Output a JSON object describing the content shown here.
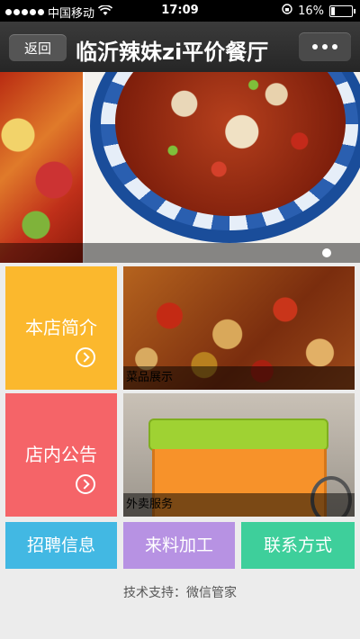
{
  "status_bar": {
    "carrier": "中国移动",
    "time": "17:09",
    "battery": "16%"
  },
  "navbar": {
    "back_label": "返回",
    "title": "临沂辣妹zi平价餐厅"
  },
  "banner": {
    "page_count": 1,
    "active_index": 0
  },
  "tiles": {
    "intro_label": "本店简介",
    "notice_label": "店内公告",
    "dishes_caption": "菜品展示",
    "delivery_caption": "外卖服务"
  },
  "buttons": {
    "recruit": "招聘信息",
    "material": "来料加工",
    "contact": "联系方式"
  },
  "colors": {
    "intro": "#fbb82d",
    "notice": "#f56468",
    "recruit": "#42b8e3",
    "material": "#b792e3",
    "contact": "#3ecf9b"
  },
  "footer": {
    "support_text": "技术支持：微信管家"
  }
}
